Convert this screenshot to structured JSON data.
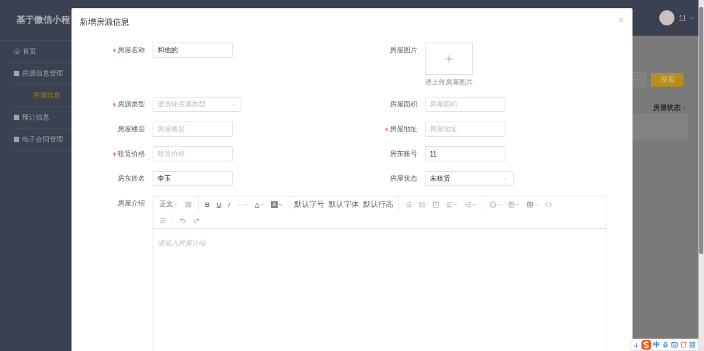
{
  "sidebar": {
    "title": "基于微信小程",
    "items": [
      {
        "label": "首页",
        "kind": "home",
        "selected": false
      },
      {
        "label": "房源信息管理",
        "kind": "doc",
        "selected": false
      },
      {
        "label": "房源信息",
        "kind": "sub",
        "selected": true
      },
      {
        "label": "预订信息",
        "kind": "doc",
        "selected": false
      },
      {
        "label": "电子合同管理",
        "kind": "doc",
        "selected": false
      }
    ]
  },
  "header": {
    "user": "11"
  },
  "filter_bar": {
    "search_button": "搜索"
  },
  "table": {
    "columns": [
      {
        "label": "房屋状态"
      }
    ]
  },
  "dialog": {
    "title": "新增房源信息",
    "fields": [
      {
        "label": "房屋名称",
        "required": true,
        "kind": "input",
        "value": "和他的"
      },
      {
        "label": "房屋图片",
        "required": false,
        "kind": "upload",
        "hint": "请上传房屋图片"
      },
      {
        "label": "房源类型",
        "required": true,
        "kind": "select",
        "placeholder": "请选择房源类型"
      },
      {
        "label": "房屋面积",
        "required": false,
        "kind": "input",
        "placeholder": "房屋面积"
      },
      {
        "label": "房屋楼层",
        "required": false,
        "kind": "input",
        "placeholder": "房屋楼层"
      },
      {
        "label": "房屋地址",
        "required": true,
        "kind": "input",
        "placeholder": "房屋地址"
      },
      {
        "label": "租赁价格",
        "required": true,
        "kind": "input",
        "placeholder": "租赁价格"
      },
      {
        "label": "房东账号",
        "required": false,
        "kind": "input",
        "value": "11"
      },
      {
        "label": "房东姓名",
        "required": false,
        "kind": "input",
        "value": "李玉"
      },
      {
        "label": "房屋状态",
        "required": false,
        "kind": "select",
        "value": "未租赁"
      },
      {
        "label": "房屋介绍",
        "required": false,
        "kind": "editor",
        "placeholder": "请输入房屋介绍",
        "toolbar_rows": [
          [
            [
              {
                "kind": "text",
                "label": "正文",
                "caret": true
              },
              {
                "kind": "quote",
                "caret": false
              }
            ],
            [
              {
                "kind": "bold",
                "label": "B",
                "caret": false
              },
              {
                "kind": "underline",
                "label": "U",
                "caret": false
              },
              {
                "kind": "italic",
                "label": "I",
                "caret": false
              },
              {
                "kind": "text",
                "label": "···",
                "caret": true
              },
              {
                "kind": "fontcolor",
                "label": "A",
                "caret": true
              },
              {
                "kind": "bgcolor",
                "label": "A",
                "caret": true
              }
            ],
            [
              {
                "kind": "wide",
                "label": "默认字号",
                "caret": false
              },
              {
                "kind": "wide",
                "label": "默认字体",
                "caret": false
              },
              {
                "kind": "wide",
                "label": "默认行高",
                "caret": false
              }
            ],
            [
              {
                "kind": "bullets",
                "caret": false
              },
              {
                "kind": "numbers",
                "caret": false
              },
              {
                "kind": "todo",
                "caret": false
              },
              {
                "kind": "align",
                "caret": true
              },
              {
                "kind": "indent",
                "caret": true
              }
            ],
            [
              {
                "kind": "emoji",
                "caret": true
              },
              {
                "kind": "image",
                "caret": true
              },
              {
                "kind": "table",
                "caret": true
              },
              {
                "kind": "code",
                "caret": false
              }
            ]
          ],
          [
            [
              {
                "kind": "divider",
                "caret": false
              }
            ],
            [
              {
                "kind": "undo",
                "caret": false
              },
              {
                "kind": "redo",
                "caret": false
              }
            ]
          ]
        ]
      }
    ]
  },
  "ime_bar": {
    "label": "中"
  }
}
